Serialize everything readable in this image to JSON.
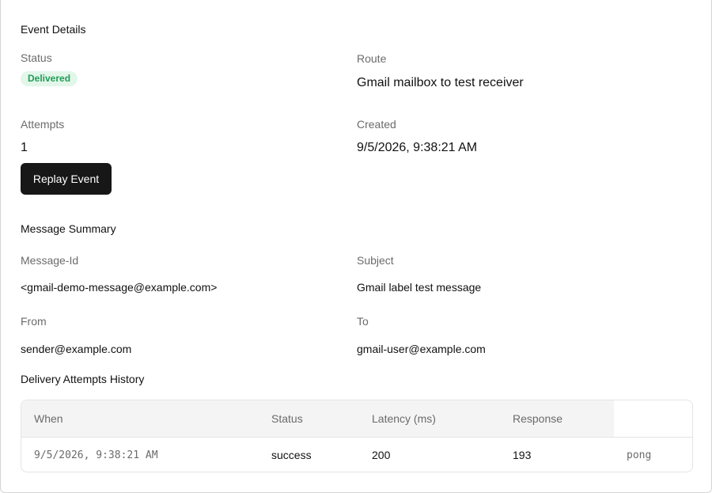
{
  "event_details": {
    "title": "Event Details",
    "status_label": "Status",
    "status_value": "Delivered",
    "route_label": "Route",
    "route_value": "Gmail mailbox to test receiver",
    "attempts_label": "Attempts",
    "attempts_value": "1",
    "created_label": "Created",
    "created_value": "9/5/2026, 9:38:21 AM",
    "replay_button": "Replay Event"
  },
  "message_summary": {
    "title": "Message Summary",
    "message_id_label": "Message-Id",
    "message_id_value": "<gmail-demo-message@example.com>",
    "subject_label": "Subject",
    "subject_value": "Gmail label test message",
    "from_label": "From",
    "from_value": "sender@example.com",
    "to_label": "To",
    "to_value": "gmail-user@example.com"
  },
  "history": {
    "title": "Delivery Attempts History",
    "columns": [
      "When",
      "Status",
      "Latency (ms)",
      "Response"
    ],
    "rows": [
      [
        "9/5/2026, 9:38:21 AM",
        "success",
        "200",
        "193",
        "pong"
      ]
    ]
  },
  "colors": {
    "badge_bg": "#e3f6ea",
    "badge_text": "#1f9d55",
    "button_bg": "#171717"
  }
}
